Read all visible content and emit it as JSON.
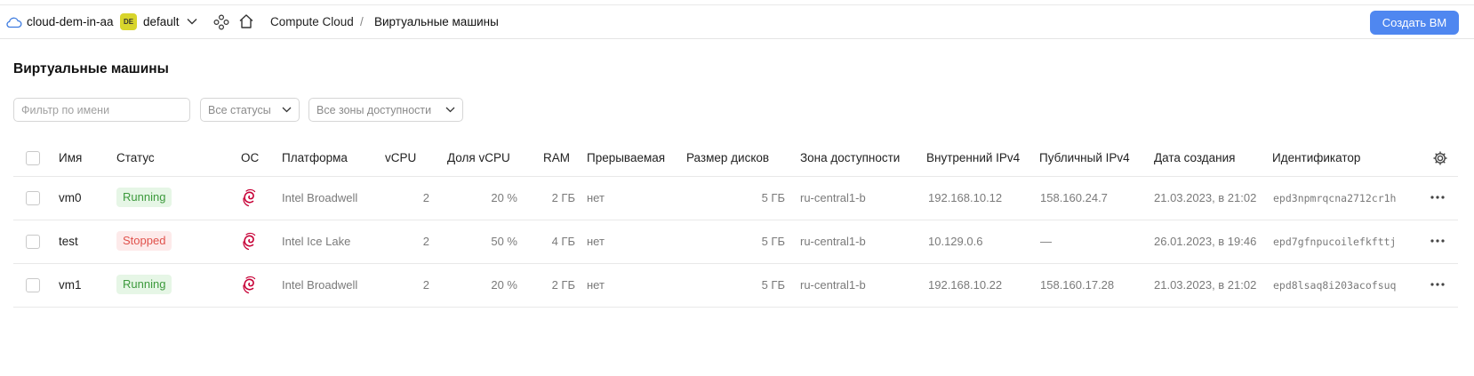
{
  "topbar": {
    "cloud_name": "cloud-dem-in-aa",
    "folder_badge": "DE",
    "folder_name": "default",
    "breadcrumb_service": "Compute Cloud",
    "breadcrumb_separator": "/",
    "breadcrumb_current": "Виртуальные машины",
    "create_button": "Создать ВМ",
    "accent_color": "#4f87f0"
  },
  "page": {
    "title": "Виртуальные машины"
  },
  "filters": {
    "name_placeholder": "Фильтр по имени",
    "name_value": "",
    "status_dropdown": "Все статусы",
    "zone_dropdown": "Все зоны доступности"
  },
  "table": {
    "columns": {
      "name": "Имя",
      "status": "Статус",
      "os": "ОС",
      "platform": "Платформа",
      "vcpu": "vCPU",
      "vcpu_share": "Доля vCPU",
      "ram": "RAM",
      "preemptible": "Прерываемая",
      "disk_size": "Размер дисков",
      "zone": "Зона доступности",
      "internal_ipv4": "Внутренний IPv4",
      "public_ipv4": "Публичный IPv4",
      "created": "Дата создания",
      "id": "Идентификатор"
    },
    "rows": [
      {
        "name": "vm0",
        "status": "Running",
        "os_icon": "debian-icon",
        "platform": "Intel Broadwell",
        "vcpu": "2",
        "vcpu_share": "20 %",
        "ram": "2 ГБ",
        "preemptible": "нет",
        "disk_size": "5 ГБ",
        "zone": "ru-central1-b",
        "internal_ipv4": "192.168.10.12",
        "public_ipv4": "158.160.24.7",
        "created": "21.03.2023, в 21:02",
        "id": "epd3npmrqcna2712cr1h"
      },
      {
        "name": "test",
        "status": "Stopped",
        "os_icon": "debian-icon",
        "platform": "Intel Ice Lake",
        "vcpu": "2",
        "vcpu_share": "50 %",
        "ram": "4 ГБ",
        "preemptible": "нет",
        "disk_size": "5 ГБ",
        "zone": "ru-central1-b",
        "internal_ipv4": "10.129.0.6",
        "public_ipv4": "—",
        "created": "26.01.2023, в 19:46",
        "id": "epd7gfnpucoilefkfttj"
      },
      {
        "name": "vm1",
        "status": "Running",
        "os_icon": "debian-icon",
        "platform": "Intel Broadwell",
        "vcpu": "2",
        "vcpu_share": "20 %",
        "ram": "2 ГБ",
        "preemptible": "нет",
        "disk_size": "5 ГБ",
        "zone": "ru-central1-b",
        "internal_ipv4": "192.168.10.22",
        "public_ipv4": "158.160.17.28",
        "created": "21.03.2023, в 21:02",
        "id": "epd8lsaq8i203acofsuq"
      }
    ]
  },
  "colors": {
    "running_bg": "#e6f6e6",
    "running_text": "#3d9a3d",
    "stopped_bg": "#fdeaea",
    "stopped_text": "#e0514b",
    "debian_red": "#c70036"
  }
}
